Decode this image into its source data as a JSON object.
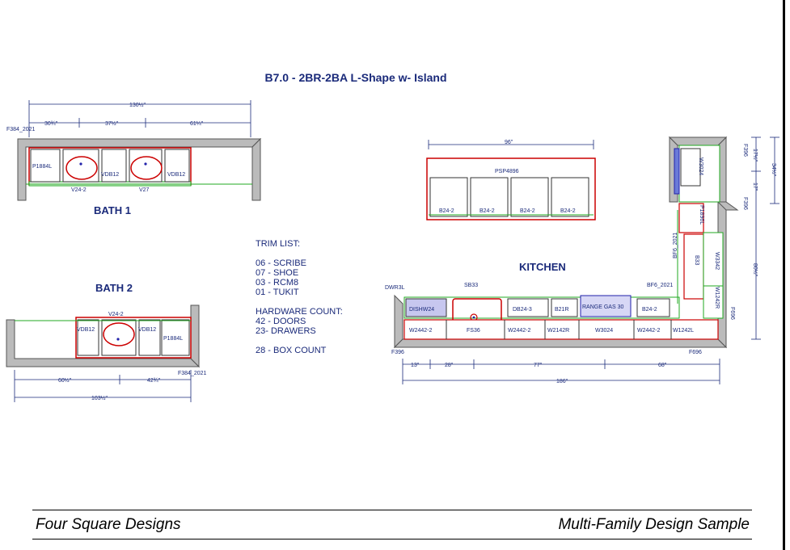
{
  "title": "B7.0 - 2BR-2BA L-Shape w- Island",
  "rooms": {
    "bath1": "BATH 1",
    "bath2": "BATH 2",
    "kitchen": "KITCHEN"
  },
  "trim": {
    "heading": "TRIM LIST:",
    "items": [
      "06 - SCRIBE",
      "07 - SHOE",
      "03 - RCM8",
      "01 - TUKIT"
    ],
    "hardware_heading": "HARDWARE COUNT:",
    "hardware": [
      "42 - DOORS",
      "23- DRAWERS"
    ],
    "box_count": "28 - BOX COUNT"
  },
  "bath1": {
    "filler": "F384_2021",
    "dims": {
      "total": "130½\"",
      "d1": "30¾\"",
      "d2": "37½\"",
      "d3": "61¼\""
    },
    "cabinets": [
      "P1884L",
      "VDB12",
      "VDB12",
      "V24-2",
      "V27"
    ]
  },
  "bath2": {
    "filler": "F384_2021",
    "dims": {
      "d1": "60½\"",
      "d2": "42¾\"",
      "total": "103½\""
    },
    "cabinets": [
      "V24-2",
      "VDB12",
      "VDB12",
      "P1884L"
    ]
  },
  "island": {
    "dim": "96\"",
    "panel": "PSP4896",
    "cabinets": [
      "B24-2",
      "B24-2",
      "B24-2",
      "B24-2"
    ]
  },
  "kitchen": {
    "upper_labels": [
      "DWR3L",
      "SB33",
      "BF6_2021",
      "BF6_2021"
    ],
    "base": [
      "DISHW24",
      "DB24-3",
      "B21R",
      "RANGE GAS 30",
      "B24-2"
    ],
    "wall": [
      "W2442-2",
      "FS36",
      "W2442-2",
      "W2142R",
      "W3024",
      "W2442-2",
      "W1242L"
    ],
    "fillers": [
      "F396",
      "F696",
      "F696",
      "F396",
      "F396"
    ],
    "side": [
      "W3024",
      "P1896L",
      "B33",
      "W3342",
      "W1242R"
    ],
    "dims_bottom": [
      "13\"",
      "28\"",
      "77\"",
      "68\""
    ],
    "dim_total": "186\"",
    "dims_right": [
      "17½\"",
      "17\"",
      "34½\"",
      "80½\""
    ]
  },
  "footer": {
    "left": "Four Square Designs",
    "right": "Multi-Family Design Sample"
  }
}
